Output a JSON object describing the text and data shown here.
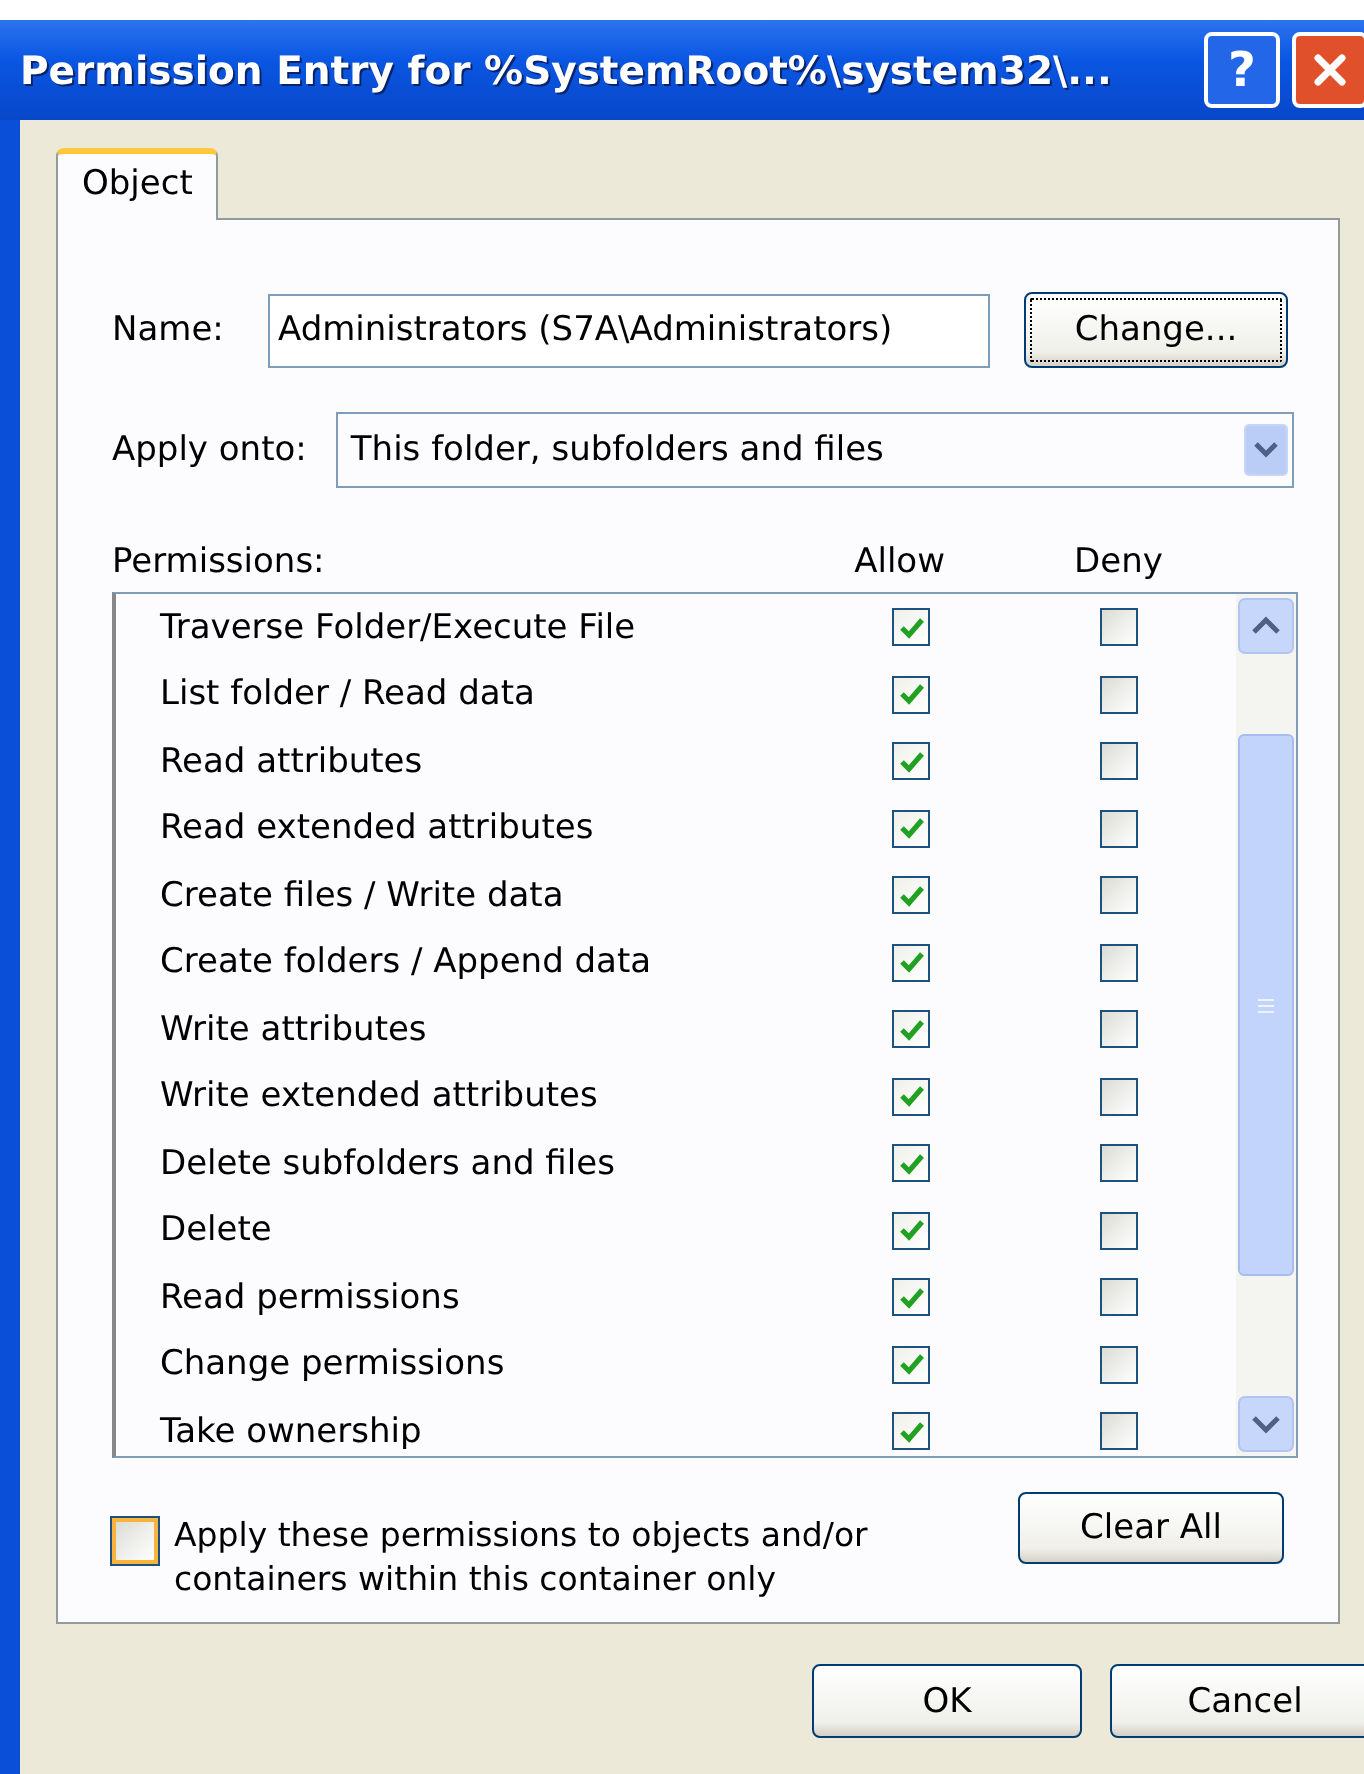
{
  "window": {
    "title": "Permission Entry for %SystemRoot%\\system32\\...",
    "help": "?"
  },
  "tabs": [
    {
      "label": "Object",
      "selected": true
    }
  ],
  "name": {
    "label": "Name:",
    "value": "Administrators (S7A\\Administrators)",
    "button": "Change..."
  },
  "apply_onto": {
    "label": "Apply onto:",
    "value": "This folder, subfolders and files"
  },
  "permissions": {
    "label": "Permissions:",
    "columns": [
      "Allow",
      "Deny"
    ],
    "rows": [
      {
        "name": "Traverse Folder/Execute File",
        "allow": true,
        "deny": false
      },
      {
        "name": "List folder / Read data",
        "allow": true,
        "deny": false
      },
      {
        "name": "Read attributes",
        "allow": true,
        "deny": false
      },
      {
        "name": "Read extended attributes",
        "allow": true,
        "deny": false
      },
      {
        "name": "Create files / Write data",
        "allow": true,
        "deny": false
      },
      {
        "name": "Create folders / Append data",
        "allow": true,
        "deny": false
      },
      {
        "name": "Write attributes",
        "allow": true,
        "deny": false
      },
      {
        "name": "Write extended attributes",
        "allow": true,
        "deny": false
      },
      {
        "name": "Delete subfolders and files",
        "allow": true,
        "deny": false
      },
      {
        "name": "Delete",
        "allow": true,
        "deny": false
      },
      {
        "name": "Read permissions",
        "allow": true,
        "deny": false
      },
      {
        "name": "Change permissions",
        "allow": true,
        "deny": false
      },
      {
        "name": "Take ownership",
        "allow": true,
        "deny": false
      }
    ]
  },
  "apply_inherit": {
    "label": "Apply these permissions to objects and/or containers within this container only",
    "checked": false
  },
  "clear_button": "Clear All",
  "buttons": [
    "OK",
    "Cancel"
  ]
}
